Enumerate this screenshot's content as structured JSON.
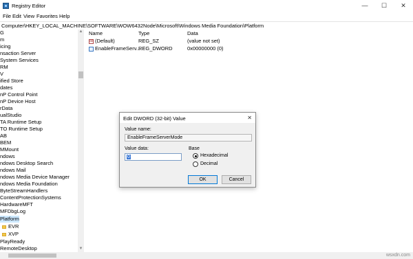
{
  "window": {
    "title": "Registry Editor",
    "min_glyph": "—",
    "max_glyph": "☐",
    "close_glyph": "✕"
  },
  "menu": [
    "File",
    "Edit",
    "View",
    "Favorites",
    "Help"
  ],
  "address": "Computer\\HKEY_LOCAL_MACHINE\\SOFTWARE\\WOW6432Node\\Microsoft\\Windows Media Foundation\\Platform",
  "tree": {
    "items": [
      {
        "label": "G"
      },
      {
        "label": "m"
      },
      {
        "label": "icing"
      },
      {
        "label": "nsaction Server"
      },
      {
        "label": " System Services"
      },
      {
        "label": "RM"
      },
      {
        "label": "V"
      },
      {
        "label": "ified Store"
      },
      {
        "label": "dates"
      },
      {
        "label": "nP Control Point"
      },
      {
        "label": "nP Device Host"
      },
      {
        "label": "rData"
      },
      {
        "label": "ualStudio"
      },
      {
        "label": "TA Runtime Setup"
      },
      {
        "label": "TO Runtime Setup"
      },
      {
        "label": "AB"
      },
      {
        "label": "BEM"
      },
      {
        "label": "MMount"
      },
      {
        "label": "ndows"
      },
      {
        "label": "ndows Desktop Search"
      },
      {
        "label": "ndows Mail"
      },
      {
        "label": "ndows Media Device Manager"
      },
      {
        "label": "ndows Media Foundation"
      },
      {
        "label": "ByteStreamHandlers"
      },
      {
        "label": "ContentProtectionSystems"
      },
      {
        "label": "HardwareMFT"
      },
      {
        "label": "MFDbgLog"
      },
      {
        "label": "Platform",
        "selected": true
      },
      {
        "label": "EVR",
        "folder": true
      },
      {
        "label": "XVP",
        "folder": true
      },
      {
        "label": "PlayReady"
      },
      {
        "label": "RemoteDesktop"
      }
    ]
  },
  "list": {
    "headers": {
      "name": "Name",
      "type": "Type",
      "data": "Data"
    },
    "rows": [
      {
        "icon": "string-value-icon",
        "name": "(Default)",
        "type": "REG_SZ",
        "data": "(value not set)"
      },
      {
        "icon": "dword-value-icon",
        "name": "EnableFrameServ...",
        "type": "REG_DWORD",
        "data": "0x00000000 (0)"
      }
    ]
  },
  "dialog": {
    "title": "Edit DWORD (32-bit) Value",
    "close_glyph": "✕",
    "value_name_label": "Value name:",
    "value_name": "EnableFrameServerMode",
    "value_data_label": "Value data:",
    "value_data": "0",
    "base_label": "Base",
    "hex_label": "Hexadecimal",
    "dec_label": "Decimal",
    "base_selected": "Hexadecimal",
    "ok_label": "OK",
    "cancel_label": "Cancel"
  },
  "watermark": "wsxdn.com"
}
